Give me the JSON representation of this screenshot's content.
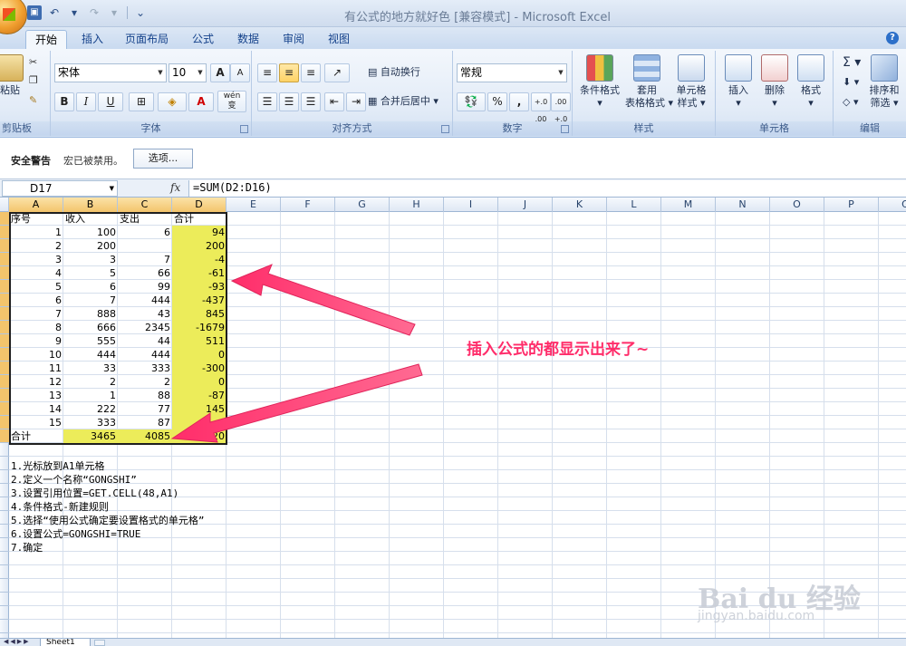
{
  "window": {
    "title": "有公式的地方就好色 [兼容模式] - Microsoft Excel"
  },
  "qat": {
    "undo_icon": "undo-icon",
    "redo_icon": "redo-icon",
    "save_icon": "save-icon",
    "customize_icon": "customize-qat-icon"
  },
  "tabs": [
    {
      "label": "开始",
      "active": true
    },
    {
      "label": "插入"
    },
    {
      "label": "页面布局"
    },
    {
      "label": "公式"
    },
    {
      "label": "数据"
    },
    {
      "label": "审阅"
    },
    {
      "label": "视图"
    }
  ],
  "ribbon": {
    "clipboard": {
      "paste": "粘贴",
      "label": "剪贴板"
    },
    "font": {
      "name": "宋体",
      "size": "10",
      "label": "字体",
      "bold": "B",
      "italic": "I",
      "underline": "U",
      "grow": "A",
      "shrink": "A",
      "font_color": "A",
      "phonetic": "wén",
      "phonetic_sub": "变"
    },
    "alignment": {
      "wrap": "自动换行",
      "merge": "合并后居中",
      "label": "对齐方式"
    },
    "number": {
      "format": "常规",
      "percent": "%",
      "comma": ",",
      "inc_decimal": "+.0 .00",
      "dec_decimal": ".00 +.0",
      "label": "数字"
    },
    "styles": {
      "conditional": "条件格式",
      "table_format_1": "套用",
      "table_format_2": "表格格式",
      "cell_style_1": "单元格",
      "cell_style_2": "样式",
      "label": "样式"
    },
    "cells": {
      "insert": "插入",
      "delete": "删除",
      "format": "格式",
      "label": "单元格"
    },
    "editing": {
      "sigma": "Σ",
      "sort_1": "排序和",
      "sort_2": "筛选",
      "label": "编辑"
    }
  },
  "security_bar": {
    "title": "安全警告",
    "message": "宏已被禁用。",
    "options_button": "选项..."
  },
  "formula_bar": {
    "name_box": "D17",
    "fx": "fx",
    "formula": "=SUM(D2:D16)"
  },
  "columns": [
    "A",
    "B",
    "C",
    "D",
    "E",
    "F",
    "G",
    "H",
    "I",
    "J",
    "K",
    "L",
    "M",
    "N",
    "O",
    "P",
    "Q"
  ],
  "table": {
    "headers": [
      "序号",
      "收入",
      "支出",
      "合计"
    ],
    "rows": [
      [
        "1",
        "100",
        "6",
        "94"
      ],
      [
        "2",
        "200",
        "",
        "200"
      ],
      [
        "3",
        "3",
        "7",
        "-4"
      ],
      [
        "4",
        "5",
        "66",
        "-61"
      ],
      [
        "5",
        "6",
        "99",
        "-93"
      ],
      [
        "6",
        "7",
        "444",
        "-437"
      ],
      [
        "7",
        "888",
        "43",
        "845"
      ],
      [
        "8",
        "666",
        "2345",
        "-1679"
      ],
      [
        "9",
        "555",
        "44",
        "511"
      ],
      [
        "10",
        "444",
        "444",
        "0"
      ],
      [
        "11",
        "33",
        "333",
        "-300"
      ],
      [
        "12",
        "2",
        "2",
        "0"
      ],
      [
        "13",
        "1",
        "88",
        "-87"
      ],
      [
        "14",
        "222",
        "77",
        "145"
      ],
      [
        "15",
        "333",
        "87",
        ""
      ]
    ],
    "total": [
      "合计",
      "3465",
      "4085",
      "-620"
    ]
  },
  "notes": [
    "1.光标放到A1单元格",
    "2.定义一个名称“GONGSHI”",
    "3.设置引用位置=GET.CELL(48,A1)",
    "4.条件格式-新建规则",
    "5.选择“使用公式确定要设置格式的单元格”",
    "6.设置公式=GONGSHI=TRUE",
    "7.确定"
  ],
  "annotation": "插入公式的都显示出来了~",
  "sheet_tabs": [
    "Sheet1"
  ],
  "watermark": {
    "main": "Bai du 经验",
    "sub": "jingyan.baidu.com"
  },
  "colors": {
    "accent": "#ff2d6a",
    "highlight": "#ecec5a",
    "ribbon": "#dfe8f5"
  }
}
